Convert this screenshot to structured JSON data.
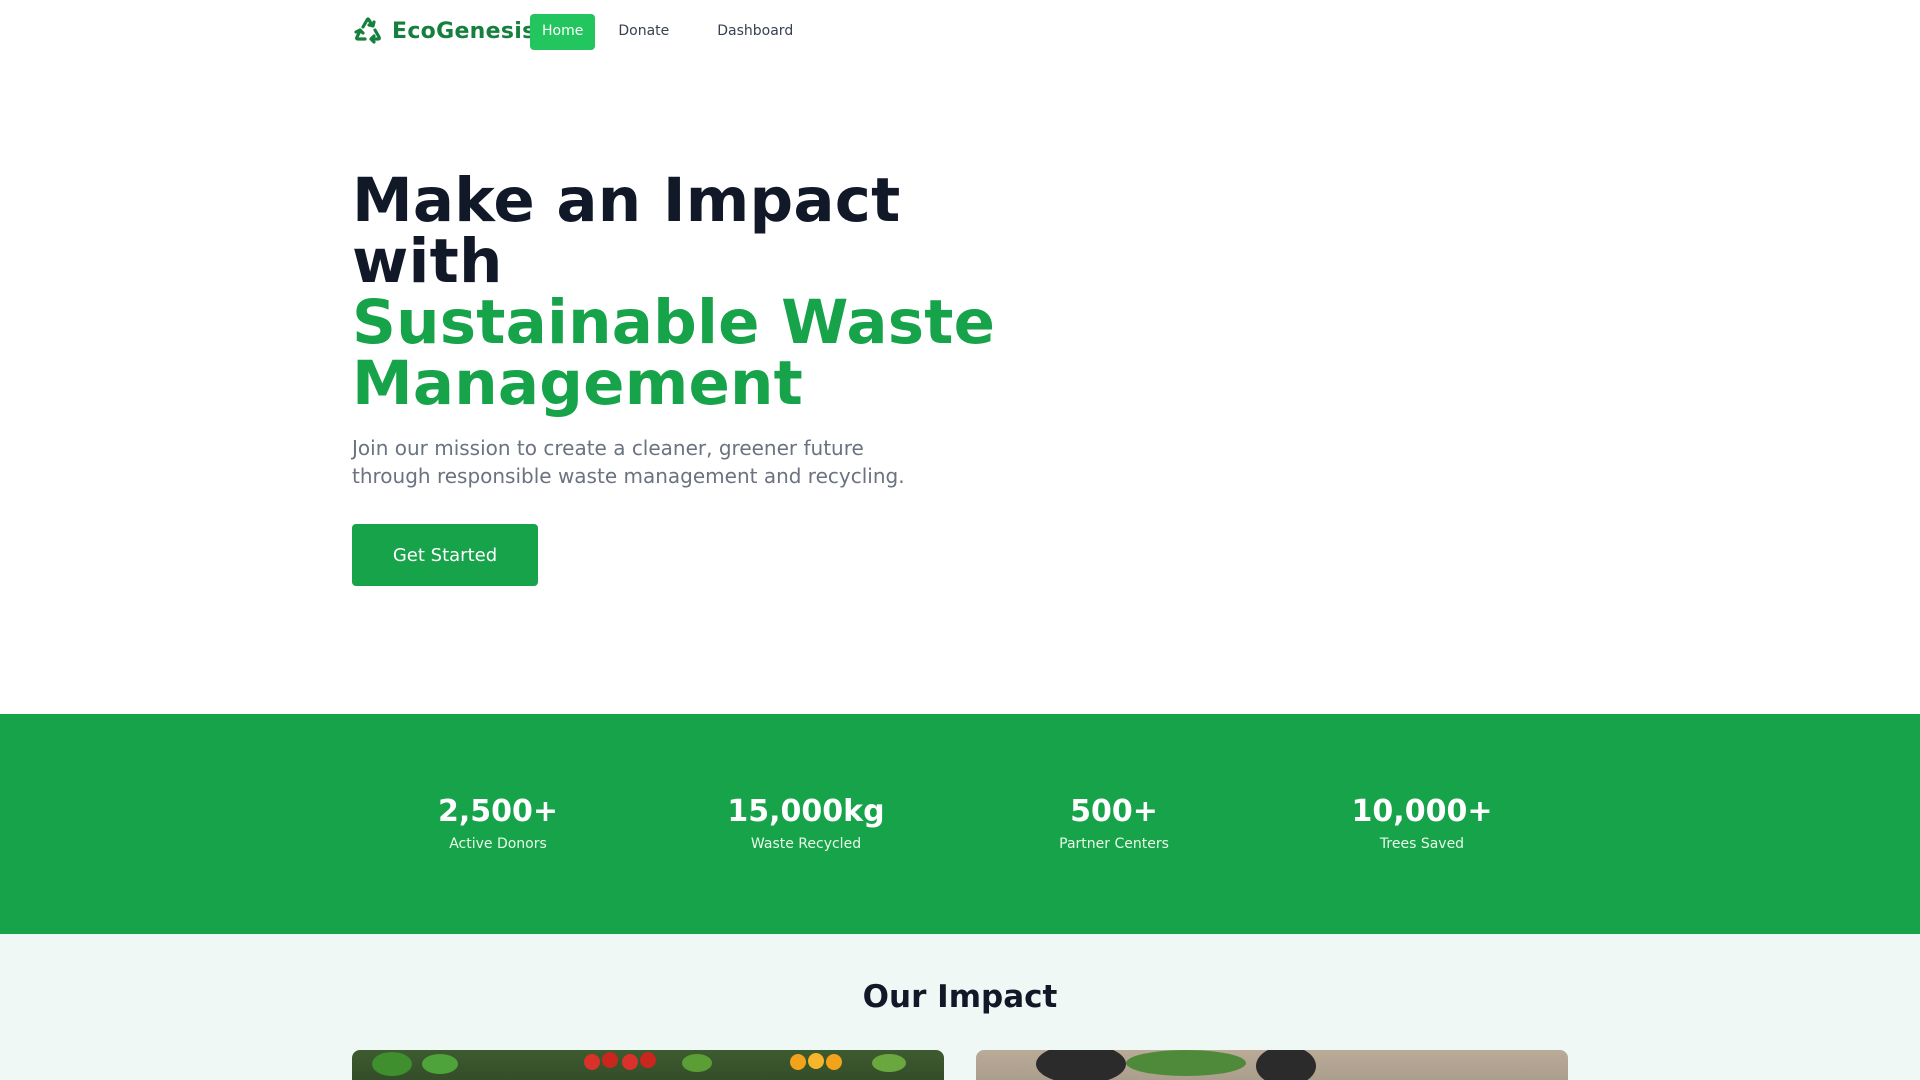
{
  "brand": {
    "name": "EcoGenesis",
    "icon": "recycle-icon",
    "color": "#15803d"
  },
  "nav": {
    "items": [
      {
        "label": "Home",
        "active": true
      },
      {
        "label": "Donate",
        "active": false
      },
      {
        "label": "Dashboard",
        "active": false
      }
    ],
    "active_color": "#22c55e"
  },
  "hero": {
    "title_line1": "Make an Impact",
    "title_line2": "with",
    "title_accent_line1": "Sustainable Waste",
    "title_accent_line2": "Management",
    "subtitle": "Join our mission to create a cleaner, greener future through responsible waste management and recycling.",
    "cta_label": "Get Started",
    "accent_color": "#16a34a"
  },
  "stats": {
    "background_color": "#16a34a",
    "items": [
      {
        "value": "2,500+",
        "label": "Active Donors"
      },
      {
        "value": "15,000kg",
        "label": "Waste Recycled"
      },
      {
        "value": "500+",
        "label": "Partner Centers"
      },
      {
        "value": "10,000+",
        "label": "Trees Saved"
      }
    ]
  },
  "impact": {
    "title": "Our Impact"
  }
}
